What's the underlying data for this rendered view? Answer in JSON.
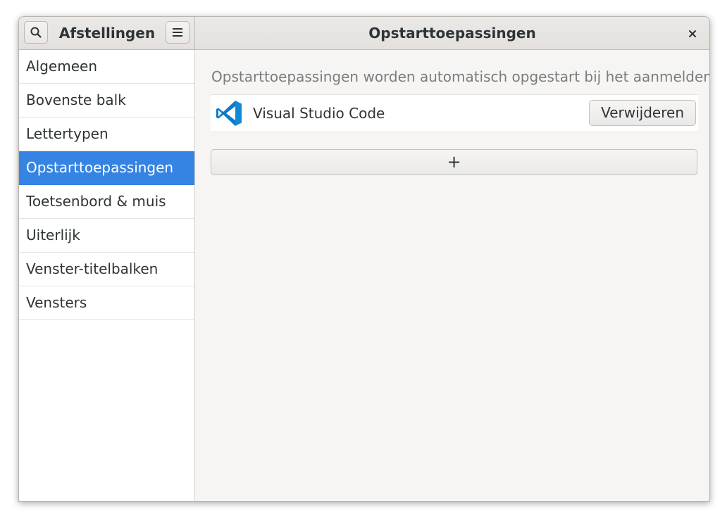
{
  "window": {
    "sidebar_title": "Afstellingen",
    "main_title": "Opstarttoepassingen"
  },
  "icons": {
    "search": "search-icon",
    "menu": "hamburger-menu-icon",
    "close": "close-icon",
    "app": "visual-studio-code-icon"
  },
  "sidebar": {
    "selected_index": 3,
    "items": [
      {
        "label": "Algemeen"
      },
      {
        "label": "Bovenste balk"
      },
      {
        "label": "Lettertypen"
      },
      {
        "label": "Opstarttoepassingen"
      },
      {
        "label": "Toetsenbord & muis"
      },
      {
        "label": "Uiterlijk"
      },
      {
        "label": "Venster-titelbalken"
      },
      {
        "label": "Vensters"
      }
    ]
  },
  "main": {
    "description": "Opstarttoepassingen worden automatisch opgestart bij het aanmelden.",
    "apps": [
      {
        "name": "Visual Studio Code",
        "remove_label": "Verwijderen"
      }
    ],
    "add_label": "+"
  },
  "colors": {
    "accent": "#3584e4",
    "vscode_blue": "#0a7acc"
  }
}
